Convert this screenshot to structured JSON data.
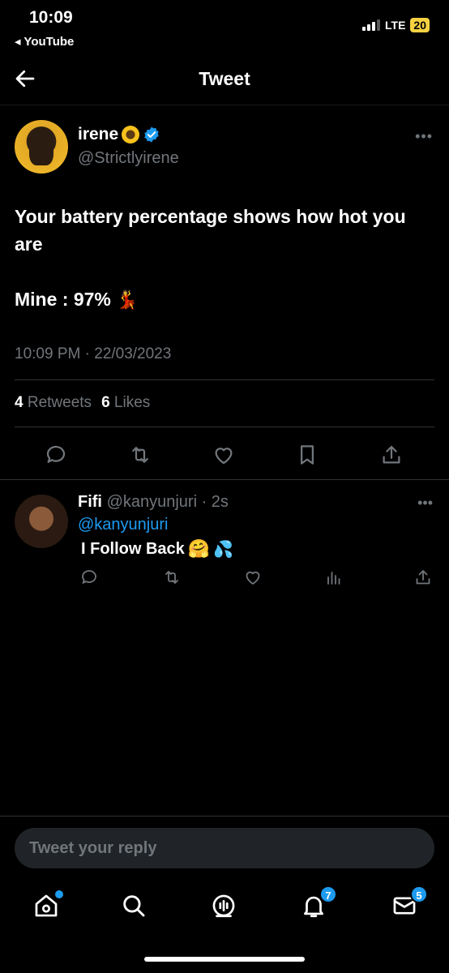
{
  "status_bar": {
    "time": "10:09",
    "back_app": "◂ YouTube",
    "network": "LTE",
    "battery": "20"
  },
  "header": {
    "title": "Tweet"
  },
  "tweet": {
    "author_name": "irene",
    "author_handle": "@Strictlyirene",
    "text_line1": "Your battery percentage shows how hot you are",
    "text_line2": "Mine : 97%",
    "timestamp": "10:09 PM · 22/03/2023",
    "retweets_count": "4",
    "retweets_label": "Retweets",
    "likes_count": "6",
    "likes_label": "Likes"
  },
  "reply": {
    "author_name": "Fifi",
    "author_handle_time": "@kanyunjuri · 2s",
    "mention": "@kanyunjuri",
    "text": "I Follow Back"
  },
  "reply_box": {
    "placeholder": "Tweet your reply"
  },
  "bottom_nav": {
    "notifications_badge": "7",
    "messages_badge": "5"
  },
  "colors": {
    "accent": "#1d9bf0",
    "background": "#000000",
    "secondary_text": "#71767b",
    "battery": "#f5d142"
  },
  "icons": [
    "back-arrow-icon",
    "verified-icon",
    "more-icon",
    "reply-icon",
    "retweet-icon",
    "like-icon",
    "bookmark-icon",
    "share-icon",
    "views-icon",
    "home-icon",
    "search-icon",
    "spaces-icon",
    "notifications-icon",
    "messages-icon"
  ]
}
